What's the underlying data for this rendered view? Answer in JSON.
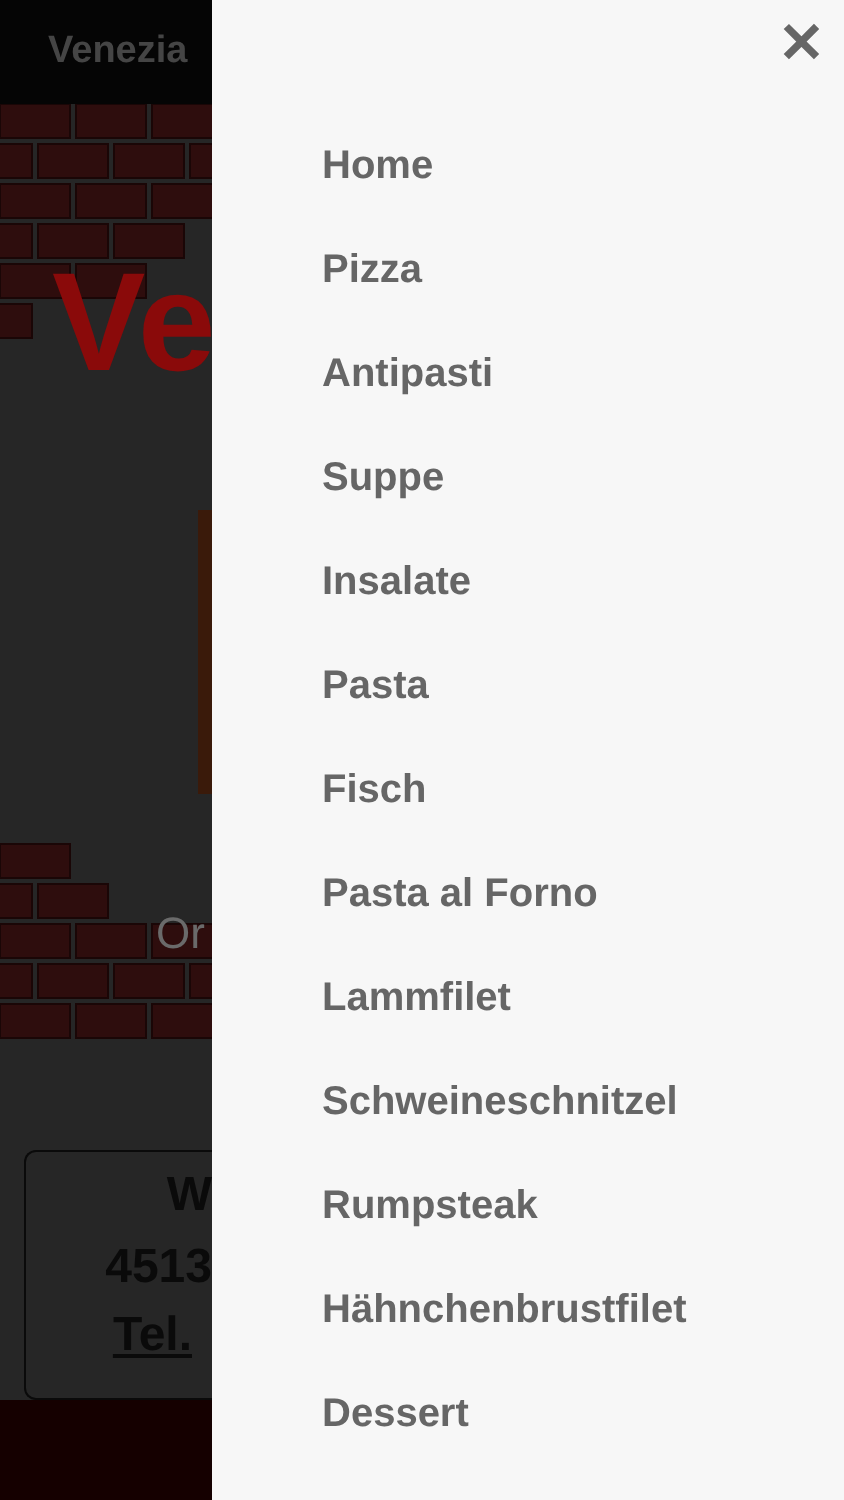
{
  "page": {
    "header_title": "Venezia",
    "hero_title": "Ve",
    "hero_caption": "Or",
    "card_lines": [
      "W",
      "4513"
    ],
    "card_link": "Tel."
  },
  "drawer": {
    "close": "✕",
    "items": [
      {
        "label": "Home"
      },
      {
        "label": "Pizza"
      },
      {
        "label": "Antipasti"
      },
      {
        "label": "Suppe"
      },
      {
        "label": "Insalate"
      },
      {
        "label": "Pasta"
      },
      {
        "label": "Fisch"
      },
      {
        "label": "Pasta al Forno"
      },
      {
        "label": "Lammfilet"
      },
      {
        "label": "Schweineschnitzel"
      },
      {
        "label": "Rumpsteak"
      },
      {
        "label": "Hähnchenbrustfilet"
      },
      {
        "label": "Dessert"
      }
    ]
  }
}
